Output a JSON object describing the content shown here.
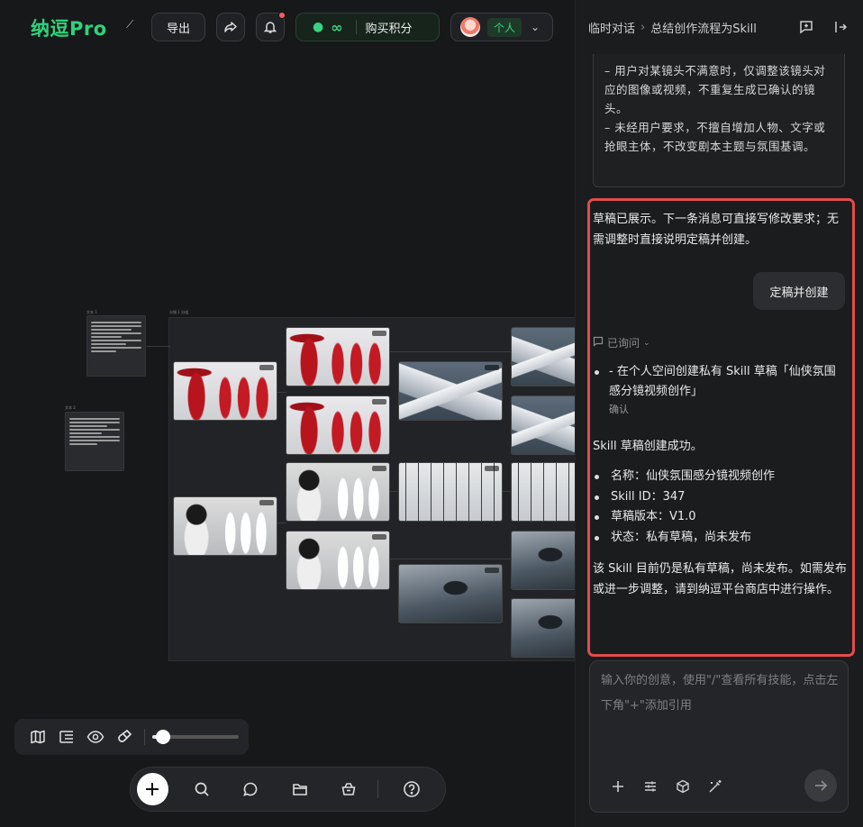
{
  "app": {
    "logo": "纳逗Pro",
    "menu_glyph": "⟋"
  },
  "toolbar": {
    "export_label": "导出",
    "credits_value": "∞",
    "buy_credits_label": "购买积分",
    "account_tag": "个人"
  },
  "canvas": {
    "board_title": "分镜 1 分组",
    "card1_label": "文本 1",
    "card2_label": "文本 2"
  },
  "panel": {
    "breadcrumb_root": "临时对话",
    "breadcrumb_current": "总结创作流程为Skill",
    "quote_text": "– 用户对某镜头不满意时，仅调整该镜头对应的图像或视频，不重复生成已确认的镜头。\n– 未经用户要求，不擅自增加人物、文字或抢眼主体，不改变剧本主题与氛围基调。",
    "assistant_msg1": "草稿已展示。下一条消息可直接写修改要求；无需调整时直接说明定稿并创建。",
    "user_msg": "定稿并创建",
    "asked_label": "已询问",
    "asked_item": "- 在个人空间创建私有 Skill 草稿「仙侠氛围感分镜视频创作」",
    "asked_confirm": "确认",
    "success_title": "Skill 草稿创建成功。",
    "info": [
      "名称：仙侠氛围感分镜视频创作",
      "Skill ID：347",
      "草稿版本：V1.0",
      "状态：私有草稿，尚未发布"
    ],
    "final_msg": "该 Skill 目前仍是私有草稿，尚未发布。如需发布或进一步调整，请到纳逗平台商店中进行操作。",
    "input_placeholder": "输入你的创意，使用\"/\"查看所有技能，点击左下角\"+\"添加引用"
  },
  "zoom": {
    "level_fraction": 0.12
  },
  "colors": {
    "brand": "#2fd37b",
    "highlight_border": "#e24c4c",
    "notification_dot": "#ff5a5f"
  }
}
